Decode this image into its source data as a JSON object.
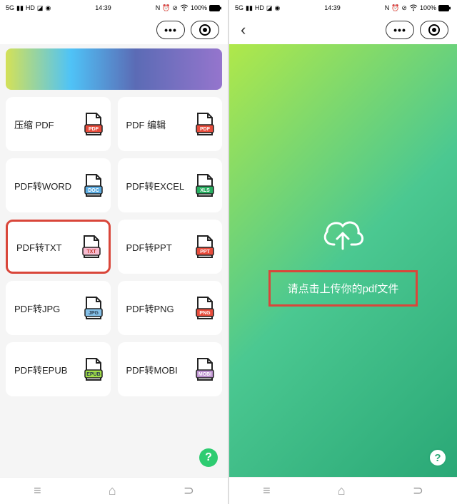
{
  "status": {
    "network": "5G",
    "time": "14:39",
    "battery": "100%"
  },
  "left": {
    "cards": [
      {
        "label": "压缩 PDF",
        "tag": "PDF",
        "fill": "#e74c3c",
        "text": "#fff",
        "selected": false
      },
      {
        "label": "PDF 编辑",
        "tag": "PDF",
        "fill": "#e74c3c",
        "text": "#fff",
        "selected": false
      },
      {
        "label": "PDF转WORD",
        "tag": "DOC",
        "fill": "#5dade2",
        "text": "#fff",
        "selected": false
      },
      {
        "label": "PDF转EXCEL",
        "tag": "XLS",
        "fill": "#27ae60",
        "text": "#fff",
        "selected": false
      },
      {
        "label": "PDF转TXT",
        "tag": "TXT",
        "fill": "#f8bbd0",
        "text": "#c0392b",
        "selected": true
      },
      {
        "label": "PDF转PPT",
        "tag": "PPT",
        "fill": "#e74c3c",
        "text": "#fff",
        "selected": false
      },
      {
        "label": "PDF转JPG",
        "tag": "JPG",
        "fill": "#85c1e9",
        "text": "#2c3e50",
        "selected": false
      },
      {
        "label": "PDF转PNG",
        "tag": "PNG",
        "fill": "#e74c3c",
        "text": "#fff",
        "selected": false
      },
      {
        "label": "PDF转EPUB",
        "tag": "EPUB",
        "fill": "#a3e048",
        "text": "#2c3e50",
        "selected": false
      },
      {
        "label": "PDF转MOBI",
        "tag": "MOBI",
        "fill": "#bb8fce",
        "text": "#fff",
        "selected": false
      }
    ],
    "fab": "?"
  },
  "right": {
    "upload_prompt": "请点击上传你的pdf文件",
    "fab": "?"
  }
}
